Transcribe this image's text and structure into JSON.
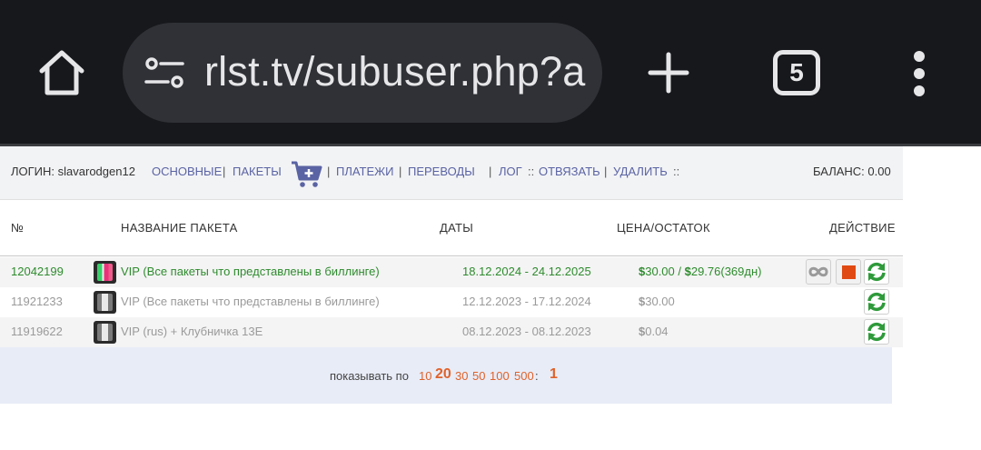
{
  "browser": {
    "url": "rlst.tv/subuser.php?a",
    "tab_count": "5"
  },
  "topbar": {
    "login_label": "ЛОГИН: slavarodgen12",
    "nav_osnovnye": "ОСНОВНЫЕ",
    "nav_pakety": "ПАКЕТЫ",
    "nav_platezhi": "ПЛАТЕЖИ",
    "nav_perevody": "ПЕРЕВОДЫ",
    "nav_log": "ЛОГ",
    "nav_otvyazat": "ОТВЯЗАТЬ",
    "nav_udalit": "УДАЛИТЬ",
    "balance": "БАЛАНС: 0.00",
    "sep_pipe": "|",
    "sep_double": "::"
  },
  "table": {
    "columns": {
      "num": "№",
      "name": "НАЗВАНИЕ ПАКЕТА",
      "dates": "ДАТЫ",
      "price": "ЦЕНА/ОСТАТОК",
      "action": "ДЕЙСТВИЕ"
    },
    "rows": [
      {
        "id": "12042199",
        "name": "VIP (Все пакеты что представлены в биллинге)",
        "dates": "18.12.2024 - 24.12.2025",
        "price_text": "30.00 / ",
        "rest_text": "29.76(369дн)",
        "active": true
      },
      {
        "id": "11921233",
        "name": "VIP (Все пакеты что представлены в биллинге)",
        "dates": "12.12.2023 - 17.12.2024",
        "price_text": "30.00",
        "active": false
      },
      {
        "id": "11919622",
        "name": "VIP (rus) + Клубничка 13E",
        "dates": "08.12.2023 - 08.12.2023",
        "price_text": "0.04",
        "active": false
      }
    ],
    "currency_symbol": "$"
  },
  "footer": {
    "show_label": "показывать по",
    "options": [
      "10",
      "20",
      "30",
      "50",
      "100",
      "500"
    ],
    "selected": "20",
    "colon": ":",
    "current_page": "1"
  },
  "colors": {
    "active_green": "#2e8b2e",
    "inactive_gray": "#9a9a9a",
    "link_blue": "#5a63a3",
    "pager_orange": "#e0622a",
    "stop_red": "#e04a12"
  }
}
